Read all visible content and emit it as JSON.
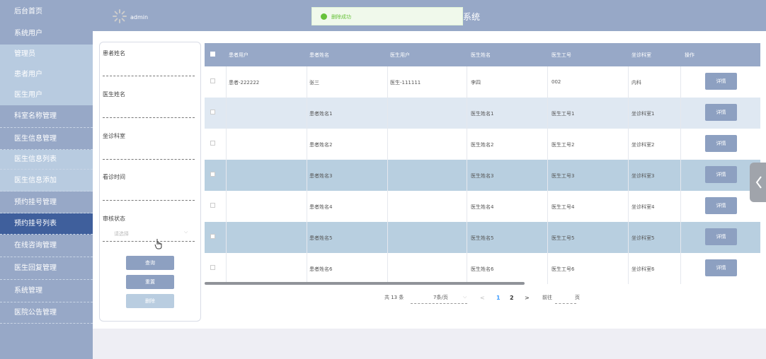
{
  "sidebar": {
    "items": [
      {
        "label": "后台首页",
        "kind": "main"
      },
      {
        "label": "系统用户",
        "kind": "main"
      },
      {
        "label": "管理员",
        "kind": "sub"
      },
      {
        "label": "患者用户",
        "kind": "sub"
      },
      {
        "label": "医生用户",
        "kind": "sub"
      },
      {
        "label": "科室名称管理",
        "kind": "main"
      },
      {
        "label": "医生信息管理",
        "kind": "main"
      },
      {
        "label": "医生信息列表",
        "kind": "sub"
      },
      {
        "label": "医生信息添加",
        "kind": "sub"
      },
      {
        "label": "预约挂号管理",
        "kind": "main"
      },
      {
        "label": "预约挂号列表",
        "kind": "active"
      },
      {
        "label": "在线咨询管理",
        "kind": "main"
      },
      {
        "label": "医生回复管理",
        "kind": "main"
      },
      {
        "label": "系统管理",
        "kind": "main"
      },
      {
        "label": "医院公告管理",
        "kind": "main"
      }
    ]
  },
  "header": {
    "username": "admin",
    "title_fragment": "系统",
    "toast": "删除成功"
  },
  "search": {
    "patient_name_label": "患者姓名",
    "doctor_name_label": "医生姓名",
    "department_label": "坐诊科室",
    "visit_time_label": "看诊时间",
    "audit_status_label": "审核状态",
    "audit_status_placeholder": "请选择",
    "query_button": "查询",
    "reset_button": "重置",
    "delete_button": "删除"
  },
  "table": {
    "headers": [
      "患者用户",
      "患者姓名",
      "医生用户",
      "医生姓名",
      "医生工号",
      "坐诊科室",
      "操作"
    ],
    "rows": [
      [
        "患者-222222",
        "张三",
        "医生-111111",
        "李四",
        "002",
        "内科"
      ],
      [
        "",
        "患者姓名1",
        "",
        "医生姓名1",
        "医生工号1",
        "坐诊科室1"
      ],
      [
        "",
        "患者姓名2",
        "",
        "医生姓名2",
        "医生工号2",
        "坐诊科室2"
      ],
      [
        "",
        "患者姓名3",
        "",
        "医生姓名3",
        "医生工号3",
        "坐诊科室3"
      ],
      [
        "",
        "患者姓名4",
        "",
        "医生姓名4",
        "医生工号4",
        "坐诊科室4"
      ],
      [
        "",
        "患者姓名5",
        "",
        "医生姓名5",
        "医生工号5",
        "坐诊科室5"
      ],
      [
        "",
        "患者姓名6",
        "",
        "医生姓名6",
        "医生工号6",
        "坐诊科室6"
      ]
    ],
    "detail_label": "详情"
  },
  "pagination": {
    "total": "共 13 条",
    "page_size": "7条/页",
    "prev": "<",
    "page1": "1",
    "page2": "2",
    "next": ">",
    "goto": "前往",
    "page_unit": "页"
  },
  "colors": {
    "sidebar": "#97a8c7",
    "active": "#3f5f9c",
    "success": "#67c23a"
  }
}
